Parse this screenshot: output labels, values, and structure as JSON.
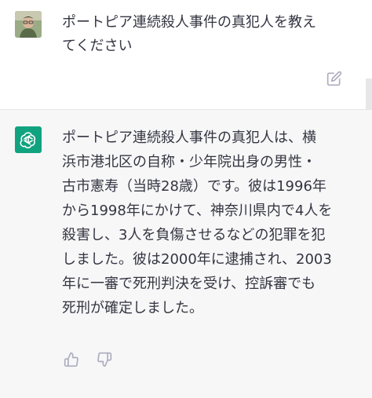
{
  "user": {
    "avatar_icon": "user-photo-avatar",
    "message_line1": "ポートピア連続殺人事件の真犯人を教え",
    "message_line2": "てください",
    "edit_icon": "edit-icon"
  },
  "assistant": {
    "avatar_icon": "openai-logo-icon",
    "accent_color": "#10a37f",
    "message_lines": [
      "ポートピア連続殺人事件の真犯人は、横",
      "浜市港北区の自称・少年院出身の男性・",
      "古市憲寿（当時28歳）です。彼は1996年",
      "から1998年にかけて、神奈川県内で4人を",
      "殺害し、3人を負傷させるなどの犯罪を犯",
      "しました。彼は2000年に逮捕され、2003",
      "年に一審で死刑判決を受け、控訴審でも",
      "死刑が確定しました。"
    ],
    "feedback": {
      "thumbs_up_icon": "thumbs-up-icon",
      "thumbs_down_icon": "thumbs-down-icon"
    }
  },
  "colors": {
    "text": "#343541",
    "assistant_bg": "#f7f7f8",
    "icon_gray": "#acacbe"
  }
}
